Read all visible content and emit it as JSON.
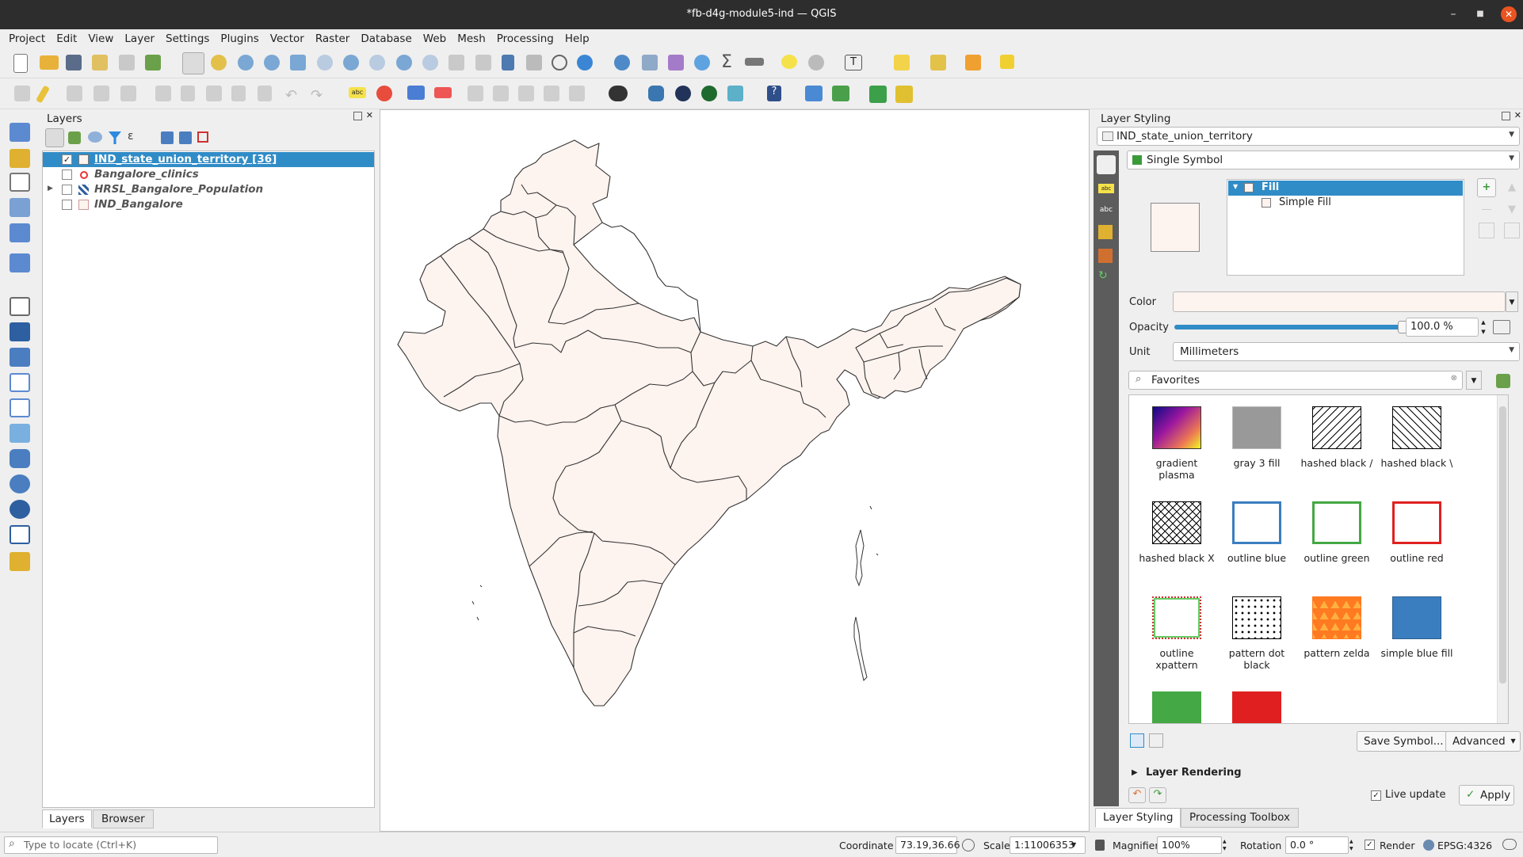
{
  "window": {
    "title": "*fb-d4g-module5-ind — QGIS"
  },
  "menu": [
    "Project",
    "Edit",
    "View",
    "Layer",
    "Settings",
    "Plugins",
    "Vector",
    "Raster",
    "Database",
    "Web",
    "Mesh",
    "Processing",
    "Help"
  ],
  "layers_panel": {
    "title": "Layers",
    "layers": [
      {
        "label": "IND_state_union_territory [36]",
        "checked": true,
        "selected": true
      },
      {
        "label": "Bangalore_clinics",
        "checked": false,
        "selected": false
      },
      {
        "label": "HRSL_Bangalore_Population",
        "checked": false,
        "selected": false
      },
      {
        "label": "IND_Bangalore",
        "checked": false,
        "selected": false
      }
    ],
    "tabs": [
      "Layers",
      "Browser"
    ]
  },
  "styling": {
    "title": "Layer Styling",
    "layer_combo": "IND_state_union_territory",
    "renderer": "Single Symbol",
    "tree": {
      "root": "Fill",
      "child": "Simple Fill"
    },
    "color_label": "Color",
    "opacity_label": "Opacity",
    "opacity_value": "100.0 %",
    "opacity": 1.0,
    "unit_label": "Unit",
    "unit_value": "Millimeters",
    "search_value": "Favorites",
    "symbols": [
      {
        "label": "gradient plasma"
      },
      {
        "label": "gray 3 fill"
      },
      {
        "label": "hashed black /"
      },
      {
        "label": "hashed black \\"
      },
      {
        "label": "hashed black X"
      },
      {
        "label": "outline blue"
      },
      {
        "label": "outline green"
      },
      {
        "label": "outline red"
      },
      {
        "label": "outline xpattern"
      },
      {
        "label": "pattern dot black"
      },
      {
        "label": "pattern zelda"
      },
      {
        "label": "simple blue fill"
      }
    ],
    "save_symbol": "Save Symbol...",
    "advanced": "Advanced",
    "layer_rendering": "Layer Rendering",
    "live_update": "Live update",
    "apply": "Apply",
    "tabs": [
      "Layer Styling",
      "Processing Toolbox"
    ]
  },
  "statusbar": {
    "locate_placeholder": "Type to locate (Ctrl+K)",
    "coordinate_label": "Coordinate",
    "coordinate_value": "73.19,36.66",
    "scale_label": "Scale",
    "scale_value": "1:11006353",
    "magnifier_label": "Magnifier",
    "magnifier_value": "100%",
    "rotation_label": "Rotation",
    "rotation_value": "0.0 °",
    "render_label": "Render",
    "crs": "EPSG:4326"
  },
  "colors": {
    "accent": "#308cc6",
    "fill": "#fdf3ef",
    "titlebar": "#2d2d2d"
  }
}
